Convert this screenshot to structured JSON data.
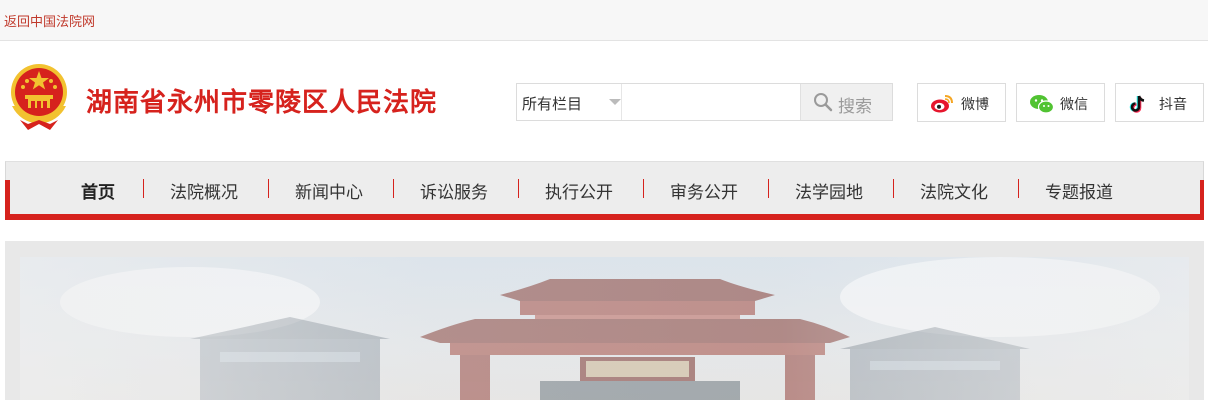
{
  "topbar": {
    "back_link": "返回中国法院网"
  },
  "header": {
    "site_title": "湖南省永州市零陵区人民法院",
    "emblem_icon": "national-emblem-icon"
  },
  "search": {
    "category_selected": "所有栏目",
    "input_value": "",
    "button_label": "搜索",
    "icon": "search-icon"
  },
  "social": [
    {
      "label": "微博",
      "icon": "weibo-icon"
    },
    {
      "label": "微信",
      "icon": "wechat-icon"
    },
    {
      "label": "抖音",
      "icon": "douyin-icon"
    }
  ],
  "nav": {
    "items": [
      {
        "label": "首页",
        "active": true
      },
      {
        "label": "法院概况"
      },
      {
        "label": "新闻中心"
      },
      {
        "label": "诉讼服务"
      },
      {
        "label": "执行公开"
      },
      {
        "label": "审务公开"
      },
      {
        "label": "法学园地"
      },
      {
        "label": "法院文化"
      },
      {
        "label": "专题报道"
      }
    ]
  },
  "colors": {
    "brand_red": "#d6221d",
    "nav_bg": "#ededed",
    "link_red": "#c0392b"
  }
}
